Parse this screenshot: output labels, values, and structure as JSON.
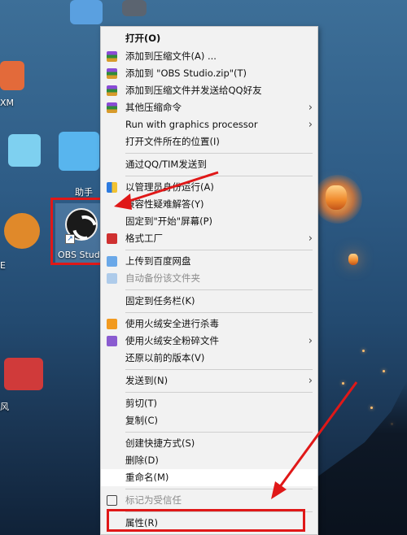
{
  "desktop": {
    "labels": {
      "helper": "助手",
      "obs": "OBS Studi",
      "left_xm": "XM",
      "left_e": "E",
      "left_feng": "风"
    }
  },
  "context_menu": {
    "items": [
      {
        "label": "打开(O)",
        "bold": true
      },
      {
        "label": "添加到压缩文件(A) ..."
      },
      {
        "label": "添加到 \"OBS Studio.zip\"(T)"
      },
      {
        "label": "添加到压缩文件并发送给QQ好友"
      },
      {
        "label": "其他压缩命令",
        "submenu": "›"
      },
      {
        "label": "Run with graphics processor",
        "submenu": "›"
      },
      {
        "label": "打开文件所在的位置(I)"
      },
      {
        "label": "通过QQ/TIM发送到"
      },
      {
        "label": "以管理员身份运行(A)"
      },
      {
        "label": "兼容性疑难解答(Y)"
      },
      {
        "label": "固定到\"开始\"屏幕(P)"
      },
      {
        "label": "格式工厂",
        "submenu": "›"
      },
      {
        "label": "上传到百度网盘"
      },
      {
        "label": "自动备份该文件夹"
      },
      {
        "label": "固定到任务栏(K)"
      },
      {
        "label": "使用火绒安全进行杀毒"
      },
      {
        "label": "使用火绒安全粉碎文件",
        "submenu": "›"
      },
      {
        "label": "还原以前的版本(V)"
      },
      {
        "label": "发送到(N)",
        "submenu": "›"
      },
      {
        "label": "剪切(T)"
      },
      {
        "label": "复制(C)"
      },
      {
        "label": "创建快捷方式(S)"
      },
      {
        "label": "删除(D)"
      },
      {
        "label": "重命名(M)"
      },
      {
        "label": "标记为受信任"
      },
      {
        "label": "属性(R)"
      }
    ]
  }
}
